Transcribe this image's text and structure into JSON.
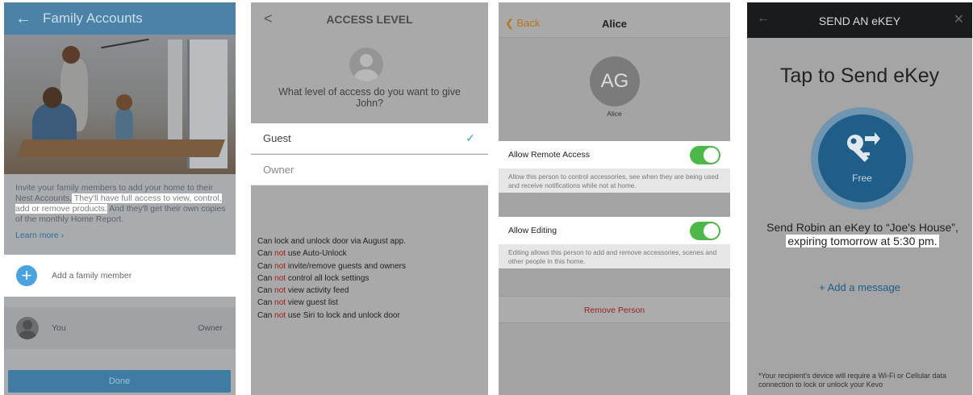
{
  "screen1": {
    "title": "Family Accounts",
    "back_icon": "←",
    "intro_a": "Invite your family members to add your home to their Nest Accounts.",
    "intro_b": " They'll have full access to view, control, add or remove products.",
    "intro_c": " And they'll get their own copies of the monthly Home Report.",
    "learn_more": "Learn more ›",
    "add_member": "Add a family member",
    "you_label": "You",
    "you_role": "Owner",
    "done": "Done"
  },
  "screen2": {
    "back_icon": "<",
    "title": "ACCESS LEVEL",
    "question": "What level of access do you want to give John?",
    "options": [
      {
        "label": "Guest",
        "selected": true
      },
      {
        "label": "Owner",
        "selected": false
      }
    ],
    "check_icon": "✓",
    "perm_can": "Can",
    "perm_not": "not",
    "perm_first": "Can lock and unlock door via August app.",
    "permissions_not": [
      "use Auto-Unlock",
      "invite/remove guests and owners",
      "control all lock settings",
      "view activity feed",
      "view guest list",
      "use Siri to lock and unlock door"
    ]
  },
  "screen3": {
    "back": "Back",
    "title": "Alice",
    "initials": "AG",
    "name": "Alice",
    "remote_label": "Allow Remote Access",
    "remote_on": true,
    "remote_desc": "Allow this person to control accessories, see when they are being used and receive notifications while not at home.",
    "edit_label": "Allow Editing",
    "edit_on": true,
    "edit_desc": "Editing allows this person to add and remove accessories, scenes and other people in this home.",
    "remove": "Remove Person"
  },
  "screen4": {
    "back_icon": "←",
    "title": "SEND AN eKEY",
    "close_icon": "✕",
    "headline": "Tap to Send eKey",
    "free": "Free",
    "msg_a": "Send Robin an eKey to “Joe's House”,",
    "msg_b": "expiring tomorrow at 5:30 pm.",
    "add_message": "+ Add a message",
    "footnote": "*Your recipient's device will require a Wi-Fi or Cellular data connection to lock or unlock your Kevo"
  },
  "colors": {
    "nest_blue": "#4b82a6",
    "toggle_green": "#4cb848",
    "kevo_blue": "#1f5e88",
    "not_red": "#a11c1c"
  }
}
